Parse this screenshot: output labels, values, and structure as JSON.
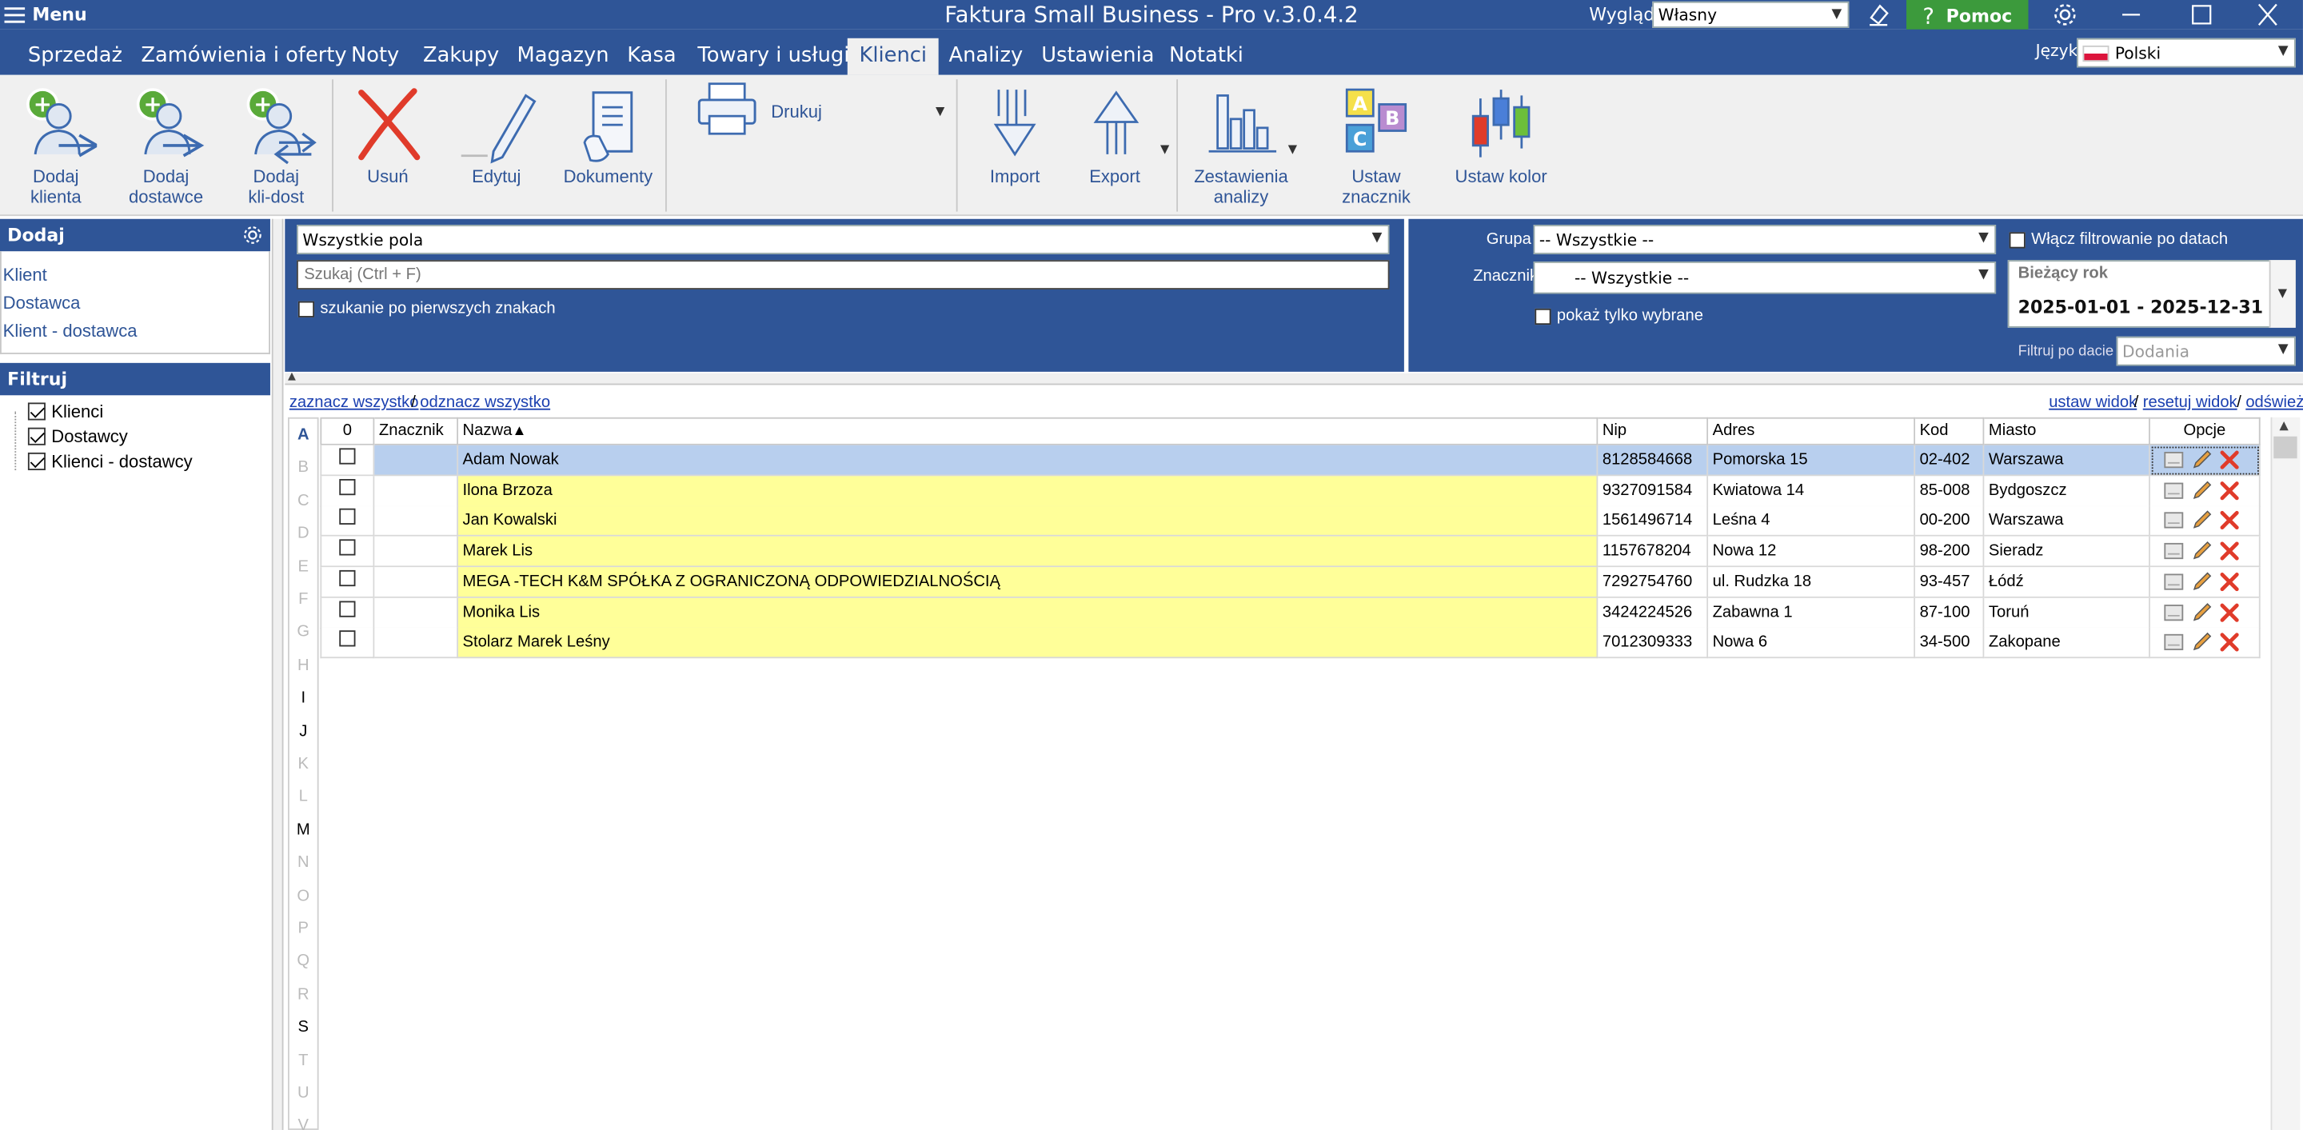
{
  "titlebar": {
    "menu_label": "Menu",
    "app_title": "Faktura Small Business - Pro v.3.0.4.2",
    "wyglad_label": "Wygląd",
    "wyglad_value": "Własny",
    "help_label": "Pomoc"
  },
  "nav": {
    "tabs": [
      "Sprzedaż",
      "Zamówienia i oferty",
      "Noty",
      "Zakupy",
      "Magazyn",
      "Kasa",
      "Towary i usługi",
      "Klienci",
      "Analizy",
      "Ustawienia",
      "Notatki"
    ],
    "active_tab": "Klienci",
    "language_label": "Język",
    "language_value": "Polski"
  },
  "ribbon": {
    "add_client": "Dodaj klienta",
    "add_supplier": "Dodaj dostawce",
    "add_client_supplier": "Dodaj kli-dost",
    "delete": "Usuń",
    "edit": "Edytuj",
    "documents": "Dokumenty",
    "print": "Drukuj",
    "import": "Import",
    "export": "Export",
    "reports": "Zestawienia analizy",
    "set_marker": "Ustaw znacznik",
    "set_color": "Ustaw kolor"
  },
  "left_panel": {
    "add_header": "Dodaj",
    "add_links": [
      "Klient",
      "Dostawca",
      "Klient - dostawca"
    ],
    "filter_header": "Filtruj",
    "filter_items": [
      {
        "label": "Klienci",
        "checked": true
      },
      {
        "label": "Dostawcy",
        "checked": true
      },
      {
        "label": "Klienci - dostawcy",
        "checked": true
      }
    ]
  },
  "search": {
    "fields_value": "Wszystkie pola",
    "placeholder": "Szukaj (Ctrl + F)",
    "first_chars_label": "szukanie po pierwszych znakach"
  },
  "filters": {
    "group_label": "Grupa",
    "group_value": "-- Wszystkie --",
    "marker_label": "Znacznik",
    "marker_value": "-- Wszystkie --",
    "show_selected_label": "pokaż tylko wybrane",
    "date_filter_label": "Włącz filtrowanie po datach",
    "period_label": "Bieżący rok",
    "date_range": "2025-01-01 - 2025-12-31",
    "filter_by_date_label": "Filtruj po dacie",
    "filter_by_date_value": "Dodania"
  },
  "grid_links": {
    "select_all": "zaznacz wszystko",
    "deselect_all": "odznacz wszystko",
    "set_view": "ustaw widok",
    "reset_view": "resetuj widok",
    "refresh": "odśwież"
  },
  "alphabet": [
    "A",
    "B",
    "C",
    "D",
    "E",
    "F",
    "G",
    "H",
    "I",
    "J",
    "K",
    "L",
    "M",
    "N",
    "O",
    "P",
    "Q",
    "R",
    "S",
    "T",
    "U",
    "V"
  ],
  "alphabet_active": [
    "A",
    "I",
    "J",
    "M",
    "S"
  ],
  "table": {
    "columns": [
      "0",
      "Znacznik",
      "Nazwa",
      "Nip",
      "Adres",
      "Kod",
      "Miasto",
      "Opcje"
    ],
    "sort_indicator": "▲",
    "rows": [
      {
        "name": "Adam Nowak",
        "nip": "8128584668",
        "address": "Pomorska 15",
        "code": "02-402",
        "city": "Warszawa",
        "selected": true
      },
      {
        "name": "Ilona Brzoza",
        "nip": "9327091584",
        "address": "Kwiatowa 14",
        "code": "85-008",
        "city": "Bydgoszcz",
        "selected": false
      },
      {
        "name": "Jan Kowalski",
        "nip": "1561496714",
        "address": "Leśna 4",
        "code": "00-200",
        "city": "Warszawa",
        "selected": false
      },
      {
        "name": "Marek Lis",
        "nip": "1157678204",
        "address": "Nowa 12",
        "code": "98-200",
        "city": "Sieradz",
        "selected": false
      },
      {
        "name": "MEGA -TECH K&M SPÓŁKA Z OGRANICZONĄ ODPOWIEDZIALNOŚCIĄ",
        "nip": "7292754760",
        "address": "ul. Rudzka 18",
        "code": "93-457",
        "city": "Łódź",
        "selected": false
      },
      {
        "name": "Monika Lis",
        "nip": "3424224526",
        "address": "Zabawna 1",
        "code": "87-100",
        "city": "Toruń",
        "selected": false
      },
      {
        "name": "Stolarz Marek Leśny",
        "nip": "7012309333",
        "address": "Nowa 6",
        "code": "34-500",
        "city": "Zakopane",
        "selected": false
      }
    ]
  },
  "colors": {
    "primary": "#2f5597",
    "help_green": "#3c9a3c",
    "row_yellow": "#ffff99",
    "row_selected": "#b8cfee",
    "delete_red": "#e03b2a"
  }
}
